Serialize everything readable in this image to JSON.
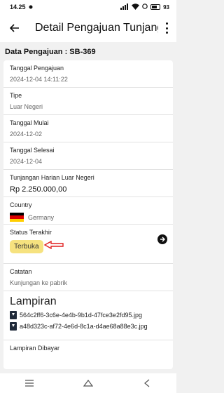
{
  "status_bar": {
    "time": "14.25",
    "battery_level": "93"
  },
  "app_bar": {
    "title": "Detail Pengajuan Tunjangan"
  },
  "section": {
    "heading": "Data Pengajuan : SB-369"
  },
  "fields": {
    "tanggal_pengajuan": {
      "label": "Tanggal Pengajuan",
      "value": "2024-12-04 14:11:22"
    },
    "tipe": {
      "label": "Tipe",
      "value": "Luar Negeri"
    },
    "tanggal_mulai": {
      "label": "Tanggal Mulai",
      "value": "2024-12-02"
    },
    "tanggal_selesai": {
      "label": "Tanggal Selesai",
      "value": "2024-12-04"
    },
    "tunjangan": {
      "label": "Tunjangan Harian Luar Negeri",
      "value": "Rp 2.250.000,00"
    },
    "country": {
      "label": "Country",
      "value": "Germany",
      "flag_colors": [
        "#000000",
        "#dd0000",
        "#ffce00"
      ]
    },
    "status": {
      "label": "Status Terakhir",
      "value": "Terbuka",
      "badge_color": "#f6e27f",
      "annotation_color": "#e02020"
    },
    "catatan": {
      "label": "Catatan",
      "value": "Kunjungan ke pabrik"
    },
    "lampiran": {
      "label": "Lampiran",
      "files": [
        "564c2ff6-3c6e-4e4b-9b1d-47fce3e2fd95.jpg",
        "a48d323c-af72-4e6d-8c1a-d4ae68a88e3c.jpg"
      ]
    },
    "lampiran_dibayar": {
      "label": "Lampiran Dibayar"
    }
  },
  "nav": {
    "icons": [
      "menu-icon",
      "home-icon",
      "back-icon"
    ]
  }
}
